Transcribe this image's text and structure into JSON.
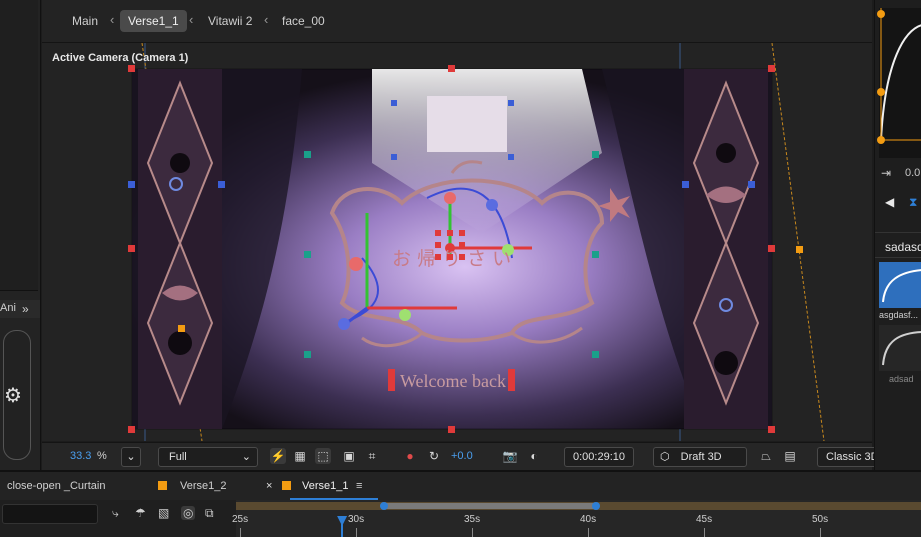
{
  "breadcrumbs": [
    "Main",
    "Verse1_1",
    "Vitawii 2",
    "face_00"
  ],
  "viewer": {
    "camera_label": "Active Camera (Camera 1)",
    "overlay_text": "Welcome back",
    "zoom_value": "33.3",
    "zoom_unit": "%",
    "resolution": "Full",
    "exposure": "+0.0",
    "timecode": "0:00:29:10",
    "renderer": "Draft 3D",
    "view_mode": "Classic 3D"
  },
  "left_panel": {
    "tab_label": "Ani",
    "expand_glyph": "»"
  },
  "right_panel": {
    "value": "0.0",
    "heading": "sadasd",
    "preset_1": "asgdasf...",
    "preset_2": "adsad"
  },
  "timeline": {
    "tabs": [
      "close-open _Curtain",
      "Verse1_2",
      "Verse1_1"
    ],
    "close_glyph": "×",
    "menu_glyph": "≡",
    "ruler_labels": [
      "25s",
      "30s",
      "35s",
      "40s",
      "45s",
      "50s"
    ],
    "playhead_time": 29.4
  },
  "colors": {
    "accent_blue": "#2e7fd6",
    "accent_orange": "#f39c12",
    "handle_red": "#e03a3a",
    "handle_teal": "#1aa08a"
  }
}
